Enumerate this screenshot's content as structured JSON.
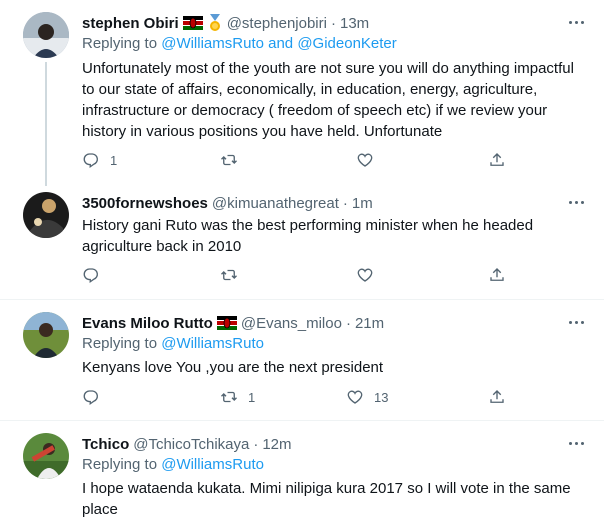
{
  "tweets": [
    {
      "name": "stephen Obiri",
      "handle": "@stephenjobiri",
      "time": "13m",
      "replying_prefix": "Replying to ",
      "replying_to": "@WilliamsRuto and @GideonKeter",
      "body": "Unfortunately most of the youth are not sure you will do anything impactful to our state of affairs, economically, in education, energy, agriculture, infrastructure or democracy ( freedom of speech etc) if we review your history in various positions you have held. Unfortunate",
      "reply_count": "1",
      "retweet_count": "",
      "like_count": "",
      "badges": [
        "kenya-flag",
        "medal"
      ]
    },
    {
      "name": "3500fornewshoes",
      "handle": "@kimuanathegreat",
      "time": "1m",
      "body": "History gani Ruto was the best performing minister when he headed agriculture back in 2010",
      "reply_count": "",
      "retweet_count": "",
      "like_count": ""
    },
    {
      "name": "Evans Miloo Rutto",
      "handle": "@Evans_miloo",
      "time": "21m",
      "replying_prefix": "Replying to ",
      "replying_to": "@WilliamsRuto",
      "body": "Kenyans love You ,you are the next president",
      "reply_count": "",
      "retweet_count": "1",
      "like_count": "13",
      "badges": [
        "kenya-flag"
      ]
    },
    {
      "name": "Tchico",
      "handle": "@TchicoTchikaya",
      "time": "12m",
      "replying_prefix": "Replying to ",
      "replying_to": "@WilliamsRuto",
      "body": "I hope wataenda kukata. Mimi nilipiga kura 2017 so I will vote in the same place"
    }
  ],
  "dot": "·",
  "colors": {
    "accent": "#1d9bf0",
    "muted": "#536471",
    "text": "#0f1419",
    "divider": "#eff3f4"
  }
}
